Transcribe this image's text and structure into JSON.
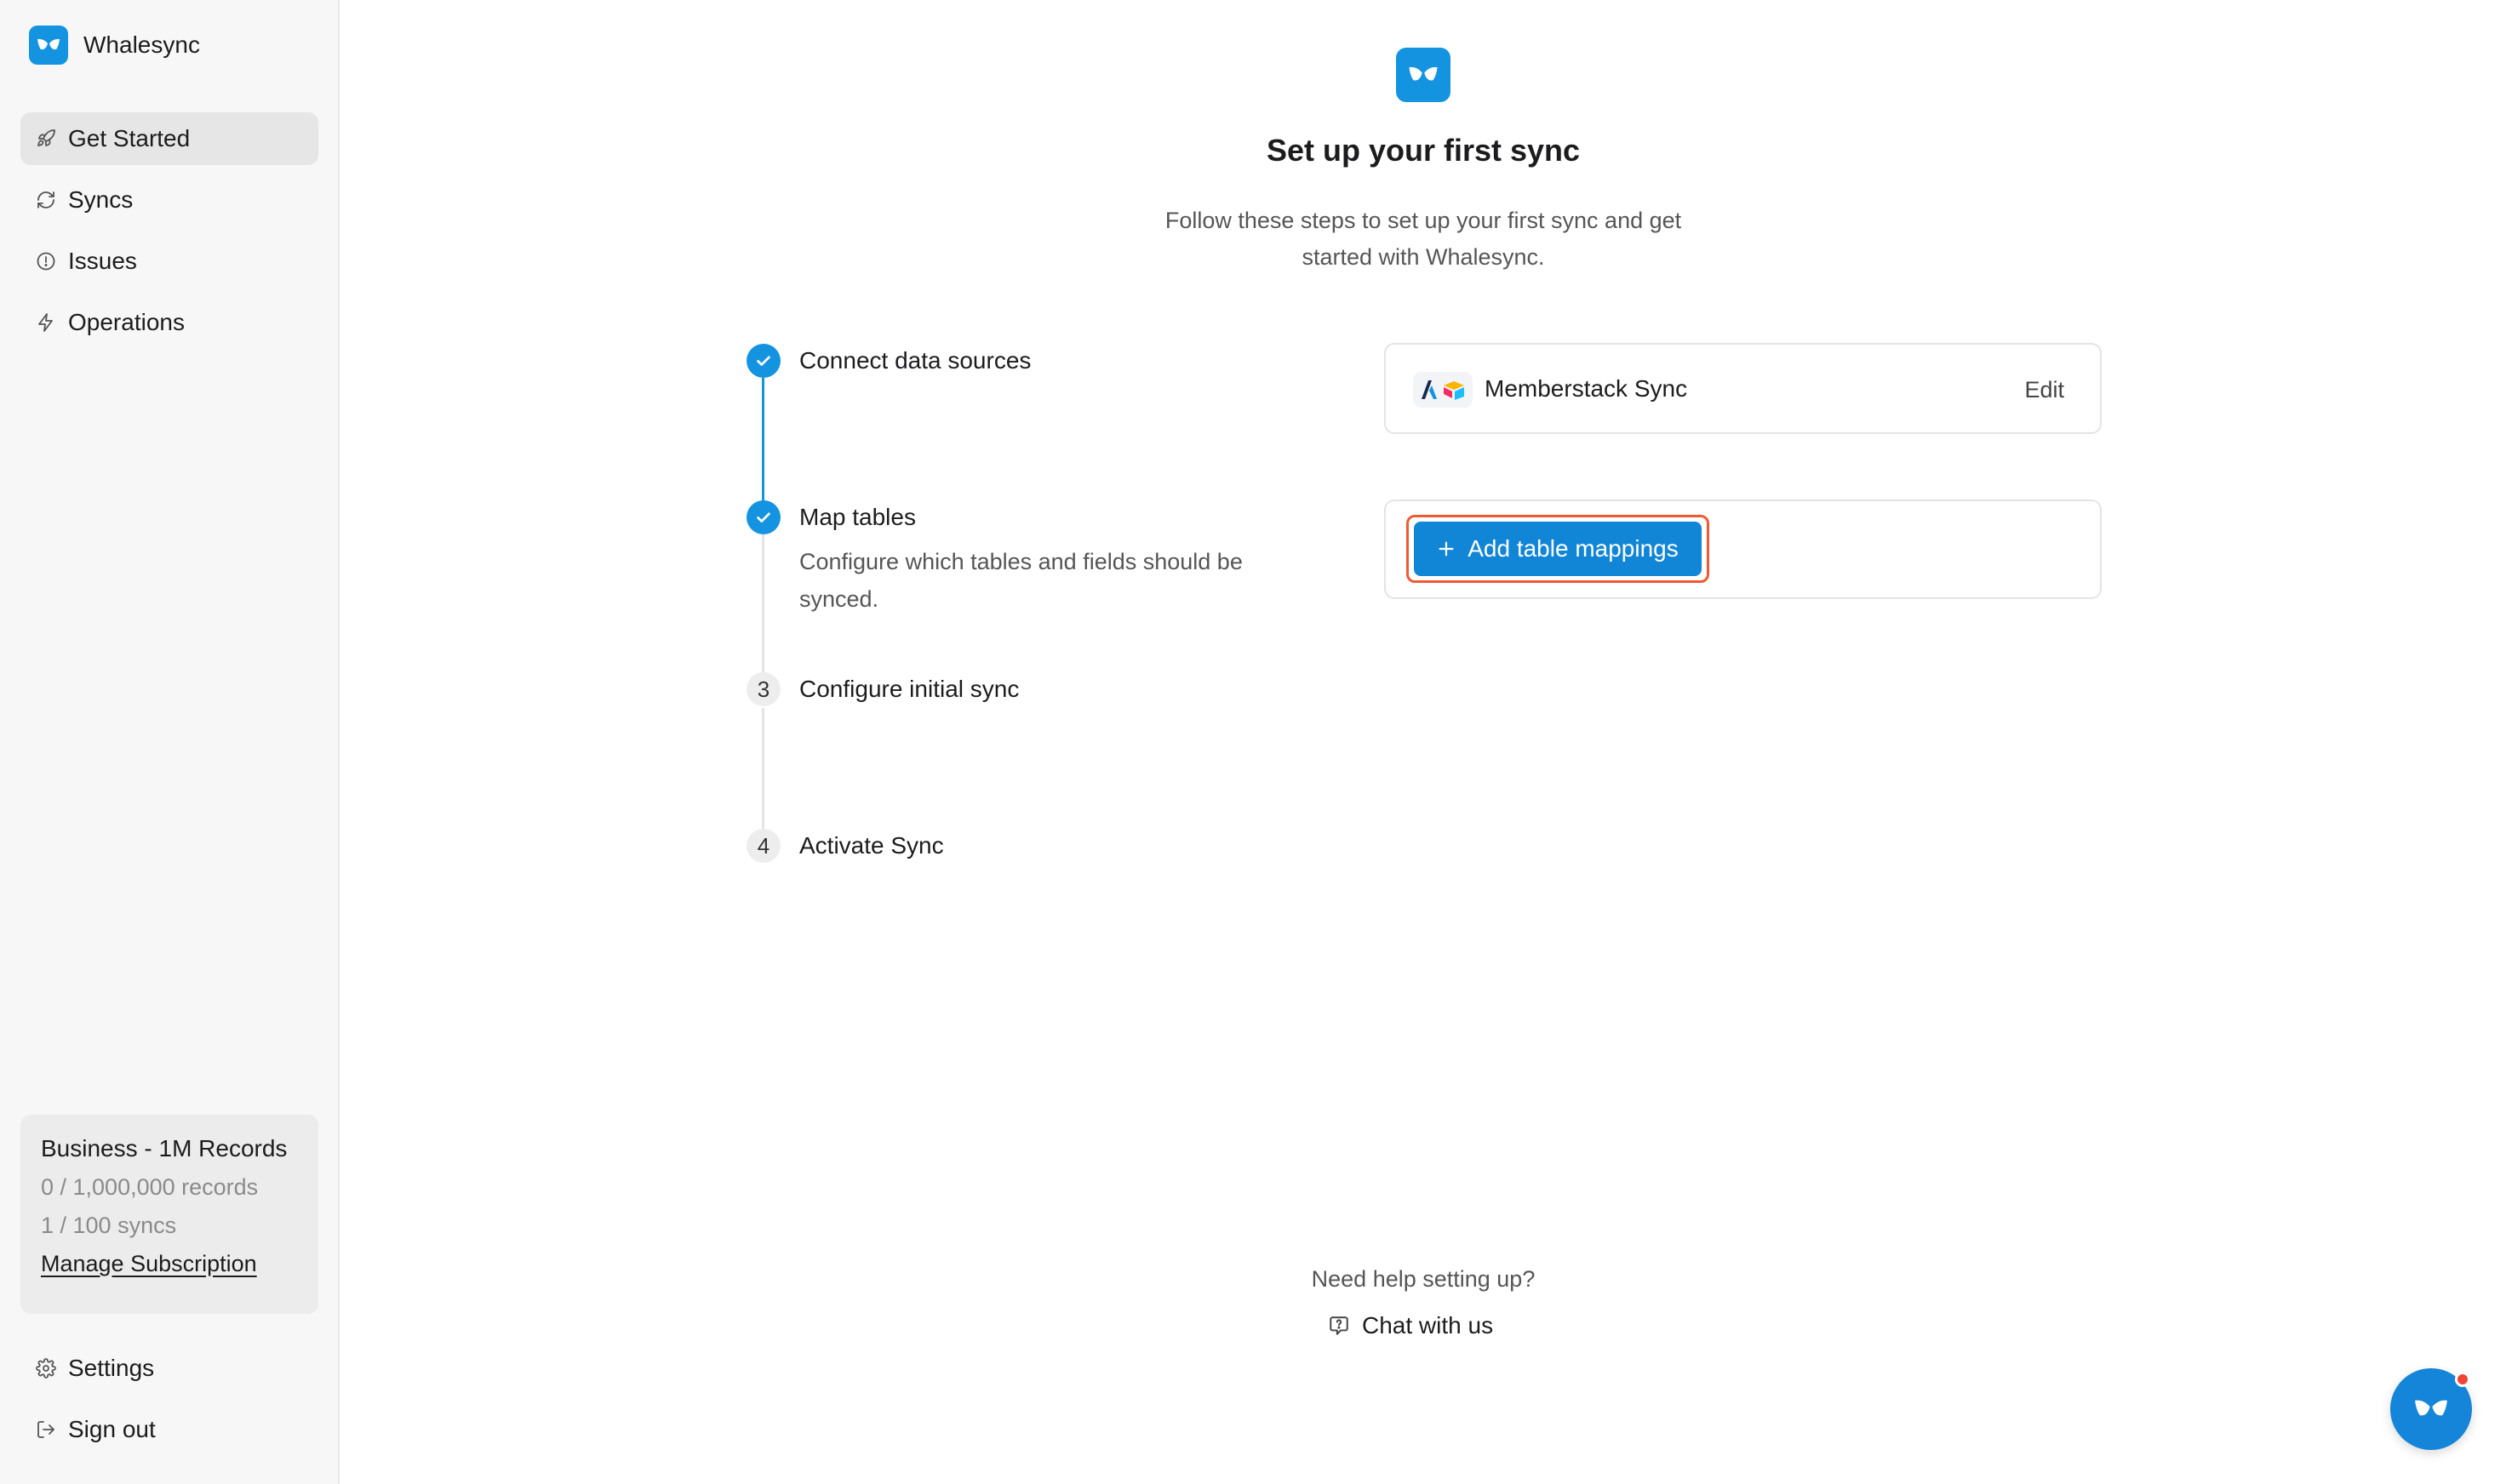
{
  "brand": {
    "name": "Whalesync"
  },
  "sidebar": {
    "items": [
      {
        "label": "Get Started",
        "icon": "rocket-icon",
        "active": true
      },
      {
        "label": "Syncs",
        "icon": "refresh-icon",
        "active": false
      },
      {
        "label": "Issues",
        "icon": "alert-circle-icon",
        "active": false
      },
      {
        "label": "Operations",
        "icon": "lightning-icon",
        "active": false
      }
    ],
    "plan": {
      "title": "Business - 1M Records",
      "records": "0 / 1,000,000 records",
      "syncs": "1 / 100 syncs",
      "manage_label": "Manage Subscription"
    },
    "bottom_items": [
      {
        "label": "Settings",
        "icon": "gear-icon"
      },
      {
        "label": "Sign out",
        "icon": "sign-out-icon"
      }
    ]
  },
  "main": {
    "title": "Set up your first sync",
    "subtitle_line1": "Follow these steps to set up your first sync and get",
    "subtitle_line2": "started with Whalesync.",
    "steps": [
      {
        "number": "1",
        "title": "Connect data sources",
        "status": "done",
        "description": ""
      },
      {
        "number": "2",
        "title": "Map tables",
        "status": "done",
        "description_line1": "Configure which tables and fields should be",
        "description_line2": "synced."
      },
      {
        "number": "3",
        "title": "Configure initial sync",
        "status": "todo",
        "description": ""
      },
      {
        "number": "4",
        "title": "Activate Sync",
        "status": "todo",
        "description": ""
      }
    ],
    "sync_card": {
      "name": "Memberstack Sync",
      "edit_label": "Edit"
    },
    "mapping_card": {
      "add_label": "Add table mappings"
    },
    "help": {
      "question": "Need help setting up?",
      "chat_label": "Chat with us"
    }
  },
  "colors": {
    "accent": "#1493e0",
    "highlight_outline": "#f05a33",
    "notification": "#f04438"
  }
}
